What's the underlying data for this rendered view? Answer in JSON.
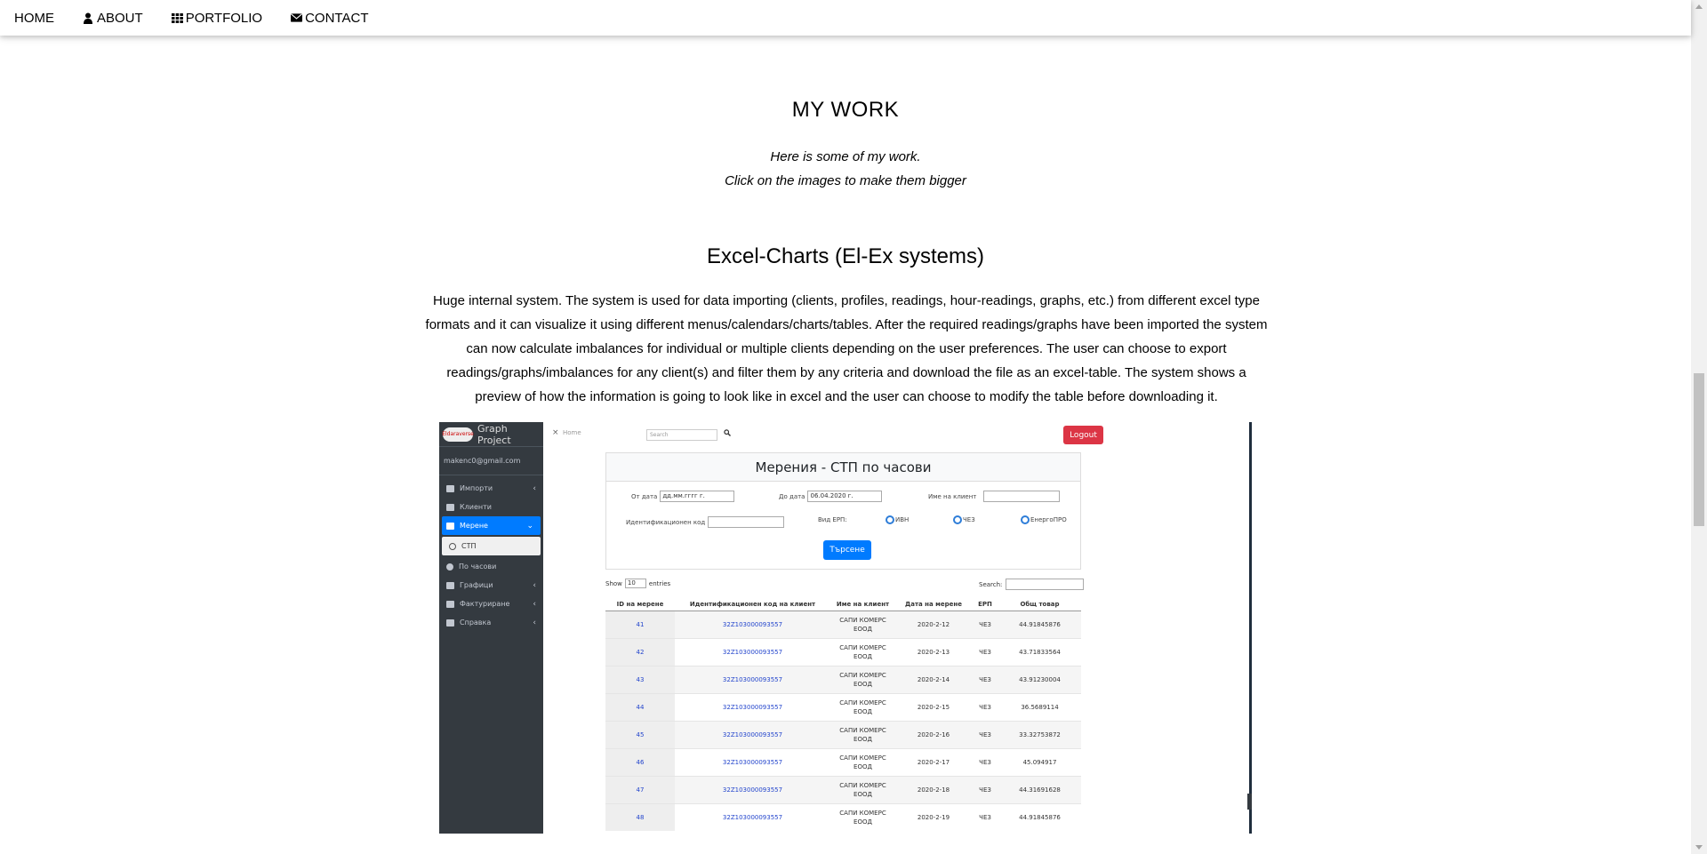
{
  "nav": {
    "items": [
      {
        "label": "HOME",
        "icon": ""
      },
      {
        "label": "ABOUT",
        "icon": "user-icon"
      },
      {
        "label": "PORTFOLIO",
        "icon": "grid-icon"
      },
      {
        "label": "CONTACT",
        "icon": "envelope-icon"
      }
    ]
  },
  "section": {
    "title": "MY WORK",
    "intro_line1": "Here is some of my work.",
    "intro_line2": "Click on the images to make them bigger"
  },
  "project": {
    "title": "Excel-Charts (El-Ex systems)",
    "description": "Huge internal system. The system is used for data importing (clients, profiles, readings, hour-readings, graphs, etc.) from different excel type formats and it can visualize it using different menus/calendars/charts/tables. After the required readings/graphs have been imported the system can now calculate imbalances for individual or multiple clients depending on the user preferences. The user can choose to export readings/graphs/imbalances for any client(s) and filter them by any criteria and download the file as an excel-table. The system shows a preview of how the information is going to look like in excel and the user can choose to modify the table before downloading it."
  },
  "screenshot": {
    "brand_logo": "Eldaraverse",
    "brand": "Graph Project",
    "user": "makenc0@gmail.com",
    "menu": [
      "Импорти",
      "Клиенти",
      "Мерене",
      "СТП",
      "По часови",
      "Графици",
      "Фактуриране",
      "Справка"
    ],
    "breadcrumb_close": "×",
    "breadcrumb": "Home",
    "search_placeholder": "Search",
    "logout": "Logout",
    "card_title": "Мерения - СТП по часови",
    "from_label": "От дата",
    "from_value": "дд.мм.гггг г.",
    "to_label": "До дата",
    "to_value": "06.04.2020 г.",
    "client_label": "Име на клиент",
    "id_label": "Идентификационен код",
    "erp_label": "Вид ЕРП:",
    "radio1": "ИВН",
    "radio2": "ЧЕЗ",
    "radio3": "ЕнергоПРО",
    "search_button": "Търсене",
    "show_label": "Show",
    "show_value": "10",
    "entries_label": "entries",
    "table_search": "Search:",
    "columns": [
      "ID на мерене",
      "Идентификационен код на клиент",
      "Име на клиент",
      "Дата на мерене",
      "ЕРП",
      "Общ товар"
    ],
    "rows": [
      [
        "41",
        "32Z103000093557",
        "САПИ КОМЕРС ЕООД",
        "2020-2-12",
        "ЧЕЗ",
        "44.91845876"
      ],
      [
        "42",
        "32Z103000093557",
        "САПИ КОМЕРС ЕООД",
        "2020-2-13",
        "ЧЕЗ",
        "43.71833564"
      ],
      [
        "43",
        "32Z103000093557",
        "САПИ КОМЕРС ЕООД",
        "2020-2-14",
        "ЧЕЗ",
        "43.91230004"
      ],
      [
        "44",
        "32Z103000093557",
        "САПИ КОМЕРС ЕООД",
        "2020-2-15",
        "ЧЕЗ",
        "36.5689114"
      ],
      [
        "45",
        "32Z103000093557",
        "САПИ КОМЕРС ЕООД",
        "2020-2-16",
        "ЧЕЗ",
        "33.32753872"
      ],
      [
        "46",
        "32Z103000093557",
        "САПИ КОМЕРС ЕООД",
        "2020-2-17",
        "ЧЕЗ",
        "45.094917"
      ],
      [
        "47",
        "32Z103000093557",
        "САПИ КОМЕРС ЕООД",
        "2020-2-18",
        "ЧЕЗ",
        "44.31691628"
      ],
      [
        "48",
        "32Z103000093557",
        "САПИ КОМЕРС ЕООД",
        "2020-2-19",
        "ЧЕЗ",
        "44.91845876"
      ]
    ]
  },
  "colors": {
    "accent": "#007bff",
    "logout": "#dc3545",
    "sidebar": "#343a40"
  }
}
